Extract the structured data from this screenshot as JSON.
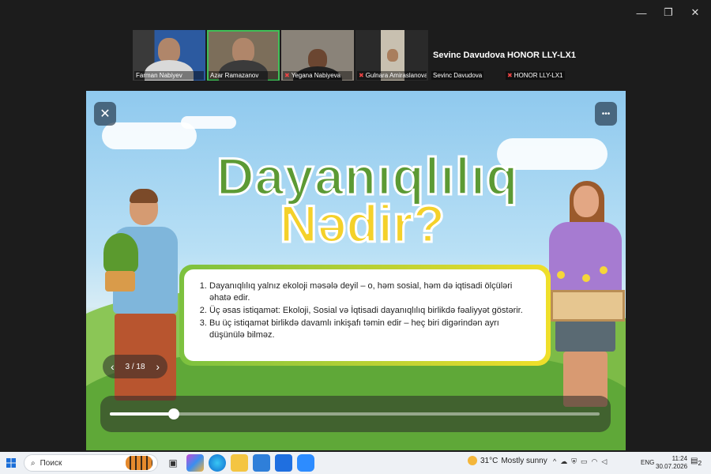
{
  "window": {
    "minimize": "—",
    "restore": "❐",
    "close": "✕"
  },
  "participants": [
    {
      "name": "Farman Nabiyev",
      "muted": false
    },
    {
      "name": "Azar Ramazanov",
      "muted": false,
      "active": true
    },
    {
      "name": "Yegana Nabiyeva",
      "muted": true
    },
    {
      "name": "Gulnara Amiraslanova",
      "muted": true
    }
  ],
  "text_participants": [
    {
      "big": "Sevinc Davudova",
      "name": "Sevinc Davudova",
      "muted": false
    },
    {
      "big": "HONOR LLY-LX1",
      "name": "HONOR LLY-LX1",
      "muted": true
    }
  ],
  "slide": {
    "close_icon": "✕",
    "more_icon": "•••",
    "title_line1": "Dayanıqlılıq",
    "title_line2": "Nədir?",
    "points": [
      "Dayanıqlılıq yalnız ekoloji məsələ deyil – o, həm sosial, həm də iqtisadi ölçüləri əhatə edir.",
      "Üç əsas istiqamət: Ekoloji, Sosial və İqtisadi dayanıqlılıq birlikdə fəaliyyət göstərir.",
      "Bu üç istiqamət birlikdə davamlı inkişafı təmin edir – heç biri digərindən ayrı düşünülə bilməz."
    ],
    "pager": {
      "prev": "‹",
      "label": "3 / 18",
      "next": "›",
      "current": 3,
      "total": 18
    },
    "progress": 0.13
  },
  "taskbar": {
    "start_icon": "windows-icon",
    "search_placeholder": "Поиск",
    "weather": {
      "temp": "31°C",
      "desc": "Mostly sunny"
    },
    "lang": "ENG",
    "time": "11:24",
    "date": "30.07.2026",
    "notif_count": "2"
  }
}
